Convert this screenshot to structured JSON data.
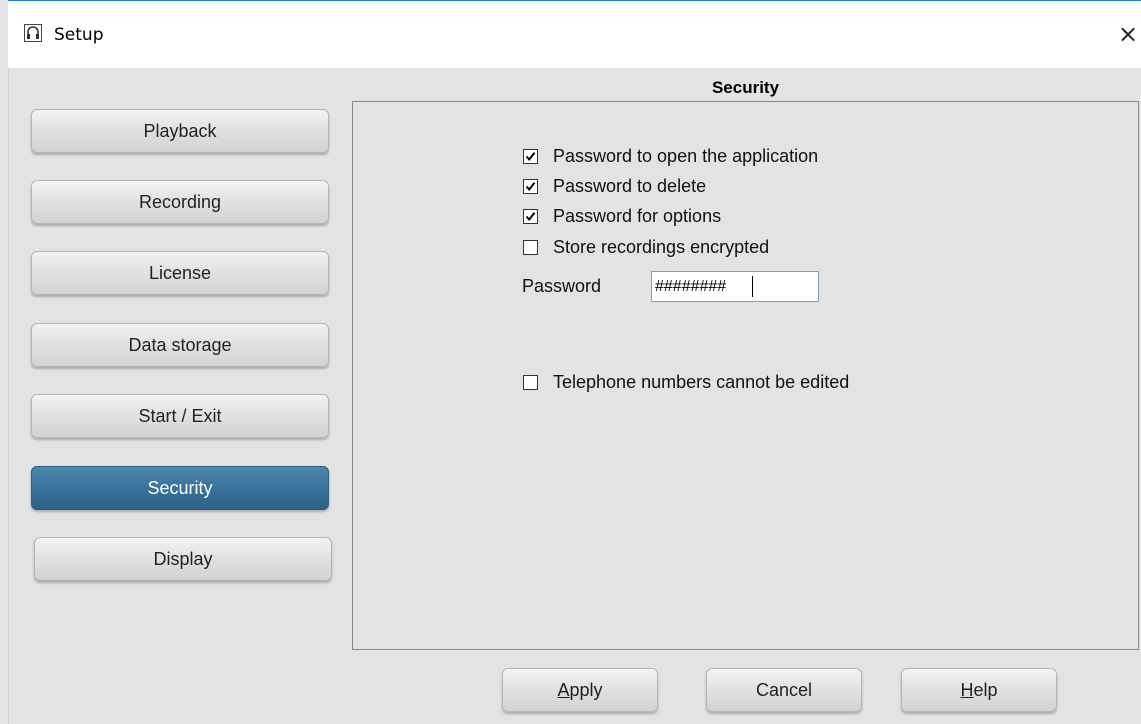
{
  "window": {
    "title": "Setup",
    "close_glyph": "×",
    "icon": "headset-icon"
  },
  "sidebar": {
    "items": [
      {
        "label": "Playback",
        "active": false
      },
      {
        "label": "Recording",
        "active": false
      },
      {
        "label": "License",
        "active": false
      },
      {
        "label": "Data storage",
        "active": false
      },
      {
        "label": "Start / Exit",
        "active": false
      },
      {
        "label": "Security",
        "active": true
      },
      {
        "label": "Display",
        "active": false
      }
    ]
  },
  "main": {
    "section_title": "Security",
    "options": [
      {
        "label": "Password to open the application",
        "checked": true
      },
      {
        "label": "Password to delete",
        "checked": true
      },
      {
        "label": "Password for options",
        "checked": true
      },
      {
        "label": "Store recordings encrypted",
        "checked": false
      }
    ],
    "password": {
      "label": "Password",
      "value": "########"
    },
    "phone_option": {
      "label": "Telephone numbers cannot be edited",
      "checked": false
    }
  },
  "footer": {
    "apply": {
      "mnemonic": "A",
      "rest": "pply"
    },
    "cancel": {
      "label": "Cancel"
    },
    "help": {
      "mnemonic": "H",
      "rest": "elp"
    }
  },
  "colors": {
    "active_nav": "#3a7299",
    "title_border": "#1c7ad4",
    "background": "#e3e3e3"
  }
}
